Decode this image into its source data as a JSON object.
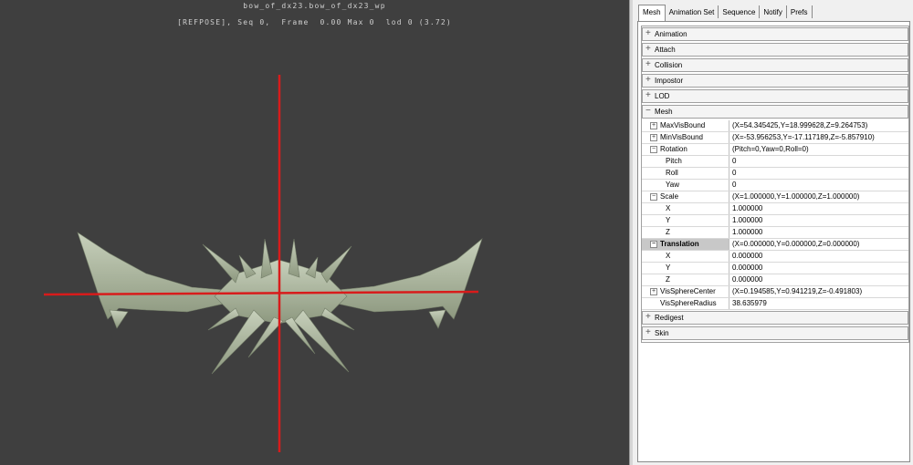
{
  "viewport": {
    "title": "bow_of_dx23.bow_of_dx23_wp",
    "status": "[REFPOSE], Seq 0,  Frame  0.00 Max 0  lod 0 (3.72)"
  },
  "tabs": [
    "Mesh",
    "Animation Set",
    "Sequence",
    "Notify",
    "Prefs"
  ],
  "categories_top": [
    {
      "sign": "+",
      "label": "Animation"
    },
    {
      "sign": "+",
      "label": "Attach"
    },
    {
      "sign": "+",
      "label": "Collision"
    },
    {
      "sign": "+",
      "label": "Impostor"
    },
    {
      "sign": "+",
      "label": "LOD"
    },
    {
      "sign": "−",
      "label": "Mesh"
    }
  ],
  "properties": [
    {
      "name": "MaxVisBound",
      "value": "(X=54.345425,Y=18.999628,Z=9.264753)",
      "expander": "+"
    },
    {
      "name": "MinVisBound",
      "value": "(X=-53.956253,Y=-17.117189,Z=-5.857910)",
      "expander": "+"
    },
    {
      "name": "Rotation",
      "value": "(Pitch=0,Yaw=0,Roll=0)",
      "expander": "−"
    },
    {
      "name": "Pitch",
      "value": "0",
      "child": true
    },
    {
      "name": "Roll",
      "value": "0",
      "child": true
    },
    {
      "name": "Yaw",
      "value": "0",
      "child": true
    },
    {
      "name": "Scale",
      "value": "(X=1.000000,Y=1.000000,Z=1.000000)",
      "expander": "−"
    },
    {
      "name": "X",
      "value": "1.000000",
      "child": true
    },
    {
      "name": "Y",
      "value": "1.000000",
      "child": true
    },
    {
      "name": "Z",
      "value": "1.000000",
      "child": true
    },
    {
      "name": "Translation",
      "value": "(X=0.000000,Y=0.000000,Z=0.000000)",
      "expander": "−",
      "selected": true
    },
    {
      "name": "X",
      "value": "0.000000",
      "child": true
    },
    {
      "name": "Y",
      "value": "0.000000",
      "child": true
    },
    {
      "name": "Z",
      "value": "0.000000",
      "child": true
    },
    {
      "name": "VisSphereCenter",
      "value": "(X=0.194585,Y=0.941219,Z=-0.491803)",
      "expander": "+"
    },
    {
      "name": "VisSphereRadius",
      "value": "38.635979"
    }
  ],
  "categories_bottom": [
    {
      "sign": "+",
      "label": "Redigest"
    },
    {
      "sign": "+",
      "label": "Skin"
    }
  ],
  "colors": {
    "viewport_bg": "#3f3f3f",
    "crosshair": "#d81b1b",
    "mesh": "#b9c3ad"
  }
}
